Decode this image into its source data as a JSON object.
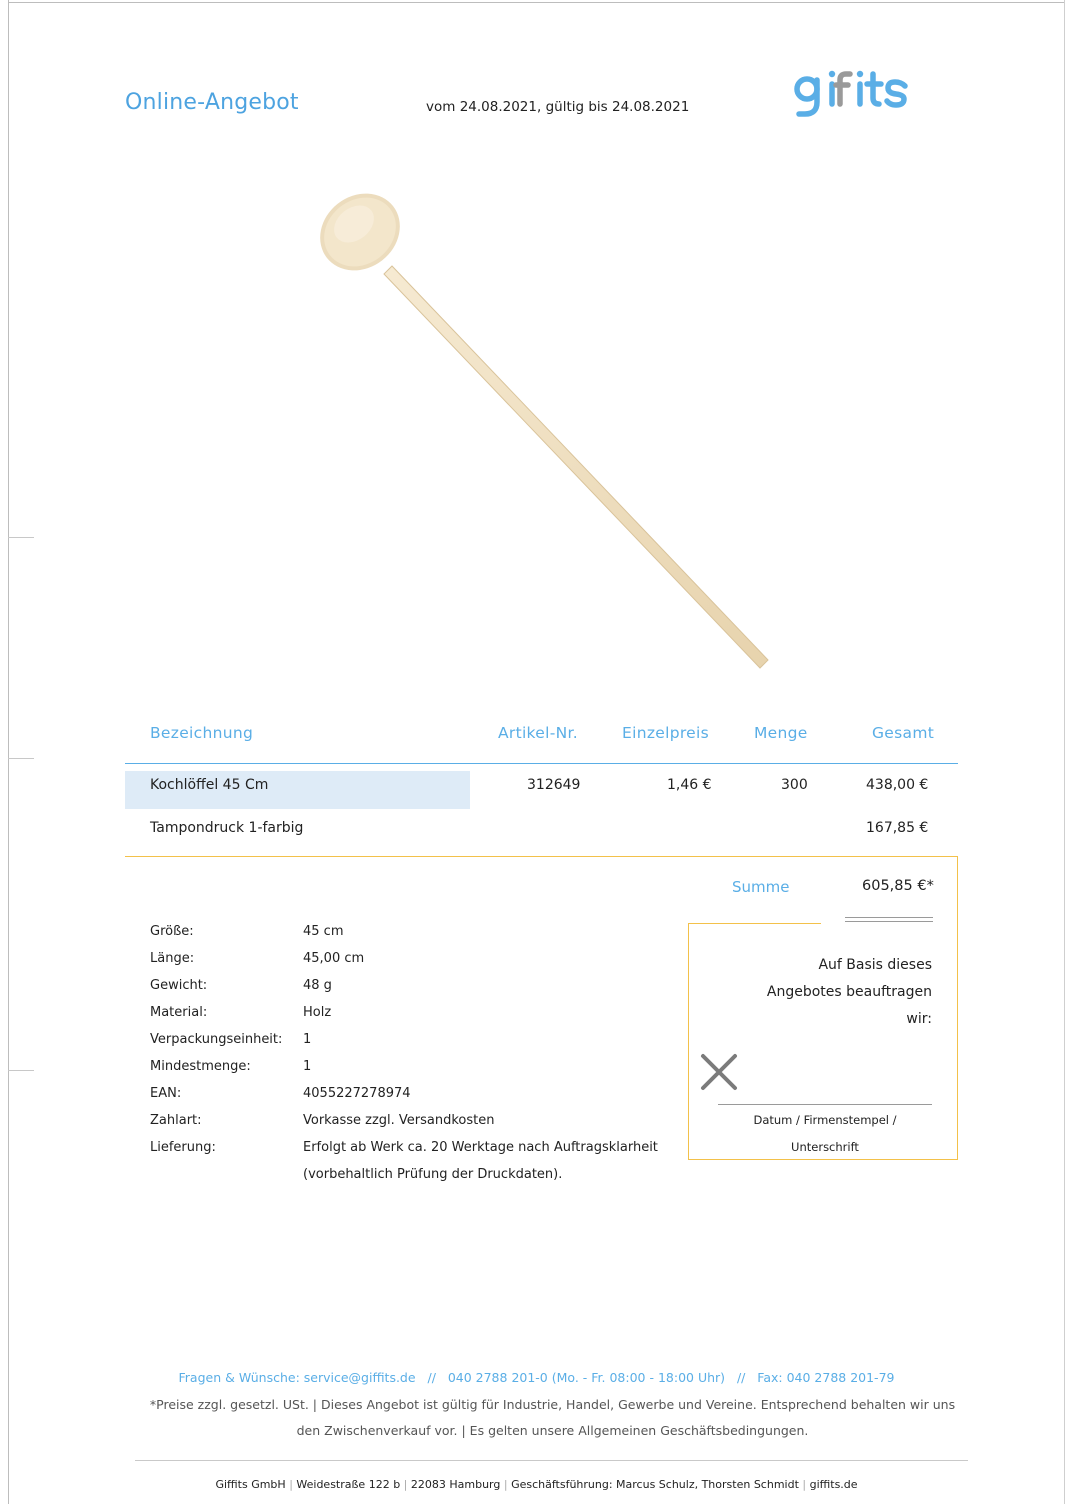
{
  "header": {
    "title": "Online-Angebot",
    "date_line": "vom 24.08.2021, gültig bis 24.08.2021",
    "logo_text": "giffits"
  },
  "table": {
    "headers": [
      "Bezeichnung",
      "Artikel-Nr.",
      "Einzelpreis",
      "Menge",
      "Gesamt"
    ],
    "rows": [
      {
        "name": "Kochlöffel 45 Cm",
        "article": "312649",
        "unit_price": "1,46 €",
        "quantity": "300",
        "total": "438,00 €"
      },
      {
        "name": "Tampondruck 1-farbig",
        "article": "",
        "unit_price": "",
        "quantity": "",
        "total": "167,85 €"
      }
    ]
  },
  "summary": {
    "label": "Summe",
    "value": "605,85 €*"
  },
  "specs": [
    {
      "label": "Größe:",
      "value": "45 cm"
    },
    {
      "label": "Länge:",
      "value": "45,00 cm"
    },
    {
      "label": "Gewicht:",
      "value": "48 g"
    },
    {
      "label": "Material:",
      "value": "Holz"
    },
    {
      "label": "Verpackungseinheit:",
      "value": "1"
    },
    {
      "label": "Mindestmenge:",
      "value": "1"
    },
    {
      "label": "EAN:",
      "value": "4055227278974"
    },
    {
      "label": "Zahlart:",
      "value": "Vorkasse zzgl. Versandkosten"
    },
    {
      "label": "Lieferung:",
      "value": "Erfolgt ab Werk ca. 20 Werktage nach Auftragsklarheit"
    },
    {
      "label": "",
      "value": "(vorbehaltlich Prüfung der Druckdaten)."
    }
  ],
  "order_box": {
    "lines": [
      "Auf Basis dieses",
      "Angebotes beauftragen",
      "wir:"
    ],
    "caption_1": "Datum / Firmenstempel /",
    "caption_2": "Unterschrift"
  },
  "footer": {
    "contact": "Fragen & Wünsche: service@giffits.de   //   040 2788 201-0 (Mo. - Fr. 08:00 - 18:00 Uhr)   //   Fax: 040 2788 201-79",
    "note_1": "*Preise zzgl. gesetzl. USt.  |  Dieses Angebot ist gültig für Industrie, Handel, Gewerbe und Vereine. Entsprechend behalten wir uns",
    "note_2": "den Zwischenverkauf vor.  |  Es gelten unsere Allgemeinen Geschäftsbedingungen.",
    "company": [
      "Giffits GmbH",
      "Weidestraße 122 b",
      "22083 Hamburg",
      "Geschäftsführung: Marcus Schulz, Thorsten Schmidt",
      "giffits.de"
    ]
  },
  "colors": {
    "accent_blue": "#5aaee6",
    "box_yellow": "#f3c14a",
    "row_highlight": "#deebf7"
  }
}
